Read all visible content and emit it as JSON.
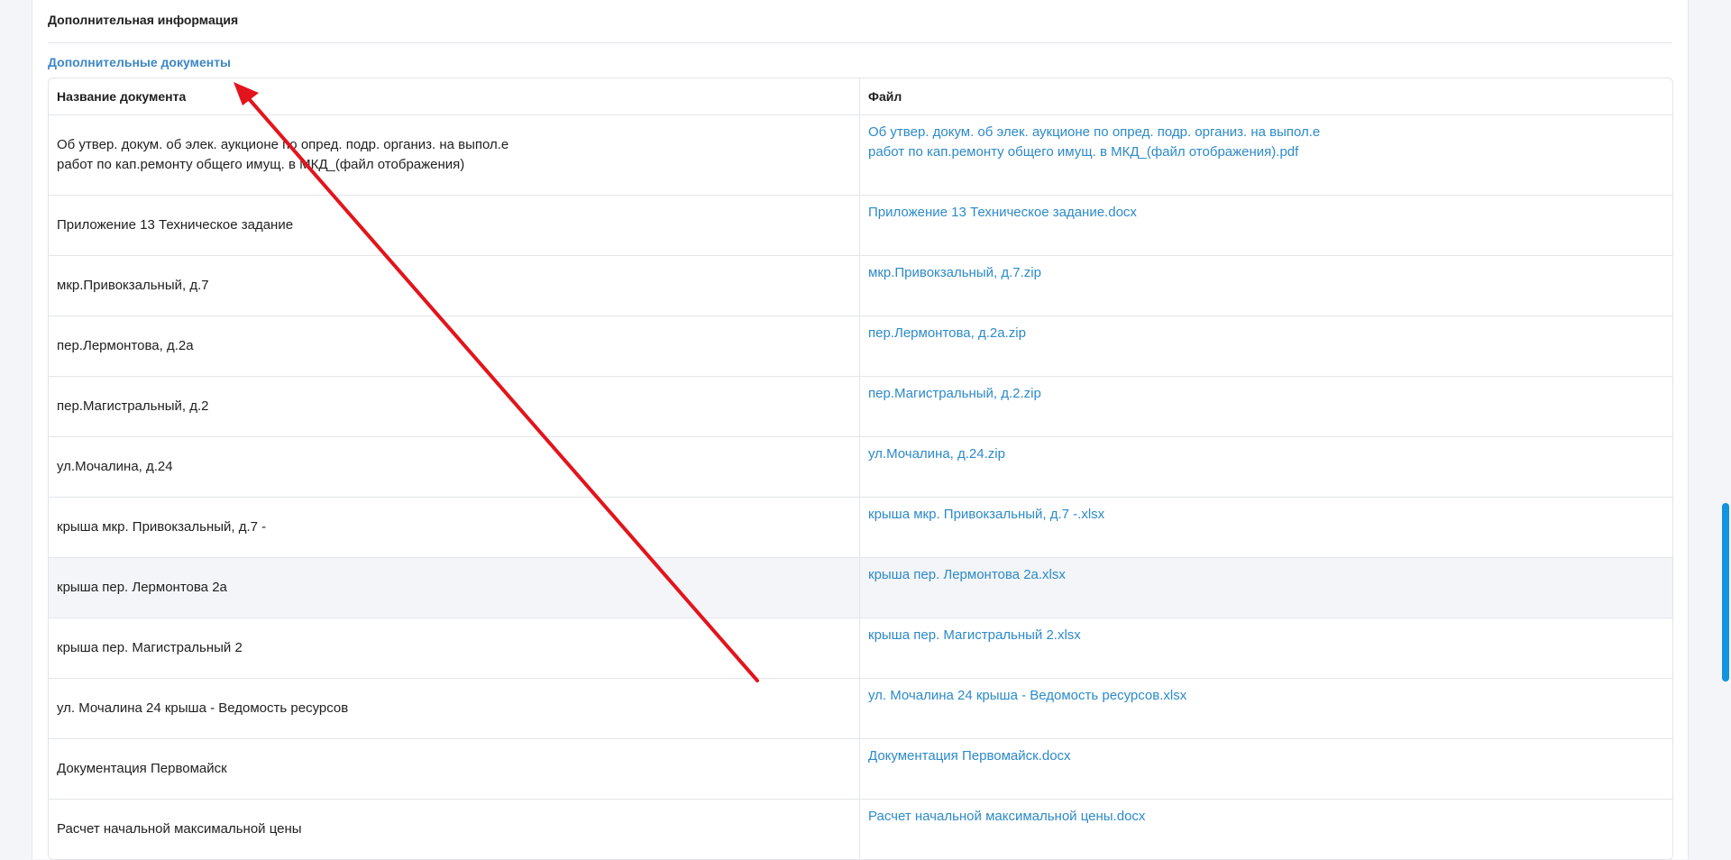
{
  "section": {
    "title": "Дополнительная информация"
  },
  "docs": {
    "title": "Дополнительные документы",
    "columns": {
      "name": "Название документа",
      "file": "Файл"
    },
    "rows": [
      {
        "name_line1": "Об утвер. докум. об элек. аукционе по опред. подр. организ. на выпол.е",
        "name_line2": "работ по кап.ремонту общего имущ. в МКД_(файл отображения)",
        "file_line1": "Об утвер. докум. об элек. аукционе по опред. подр. организ. на выпол.е",
        "file_line2": "работ по кап.ремонту общего имущ. в МКД_(файл отображения).pdf"
      },
      {
        "name": "Приложение 13 Техническое задание",
        "file": "Приложение 13 Техническое задание.docx"
      },
      {
        "name": "мкр.Привокзальный, д.7",
        "file": "мкр.Привокзальный, д.7.zip"
      },
      {
        "name": "пер.Лермонтова, д.2а",
        "file": "пер.Лермонтова, д.2а.zip"
      },
      {
        "name": "пер.Магистральный, д.2",
        "file": "пер.Магистральный, д.2.zip"
      },
      {
        "name": "ул.Мочалина, д.24",
        "file": "ул.Мочалина, д.24.zip"
      },
      {
        "name": "крыша мкр. Привокзальный, д.7 -",
        "file": "крыша мкр. Привокзальный, д.7 -.xlsx"
      },
      {
        "name": "крыша пер. Лермонтова 2а",
        "file": "крыша пер. Лермонтова 2а.xlsx"
      },
      {
        "name": "крыша пер. Магистральный 2",
        "file": "крыша пер. Магистральный 2.xlsx"
      },
      {
        "name": "ул. Мочалина 24 крыша - Ведомость ресурсов",
        "file": "ул. Мочалина 24 крыша - Ведомость ресурсов.xlsx"
      },
      {
        "name": "Документация Первомайск",
        "file": "Документация Первомайск.docx"
      },
      {
        "name": "Расчет начальной максимальной цены",
        "file": "Расчет начальной максимальной цены.docx"
      }
    ]
  },
  "colors": {
    "link": "#2c8ac9",
    "subtitle": "#3d87c6",
    "annotation_arrow": "#e3141c",
    "scrollbar": "#1294dd"
  },
  "icons": {
    "annotation": "red-arrow-icon"
  }
}
